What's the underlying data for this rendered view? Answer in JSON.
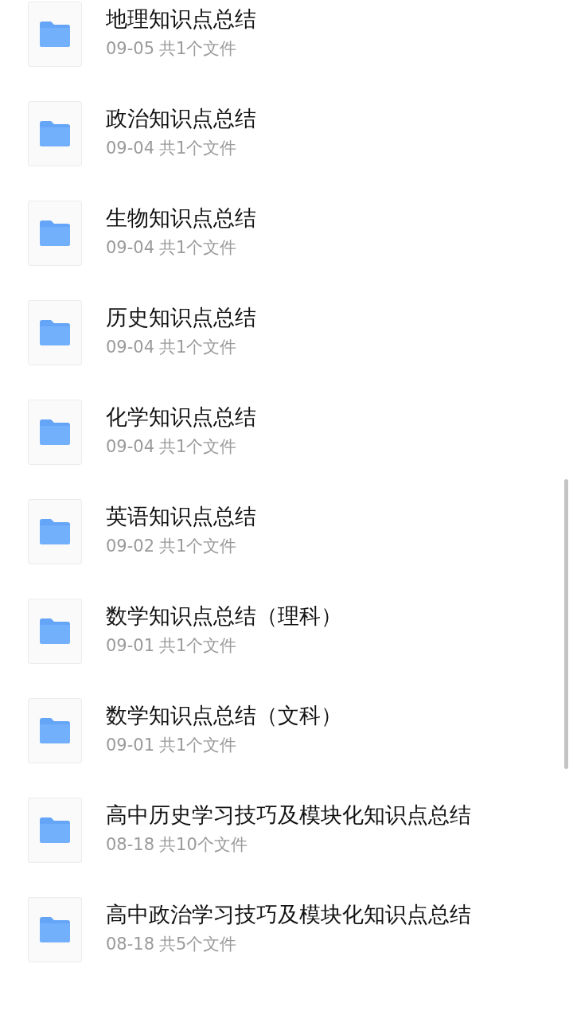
{
  "folders": [
    {
      "name": "地理知识点总结",
      "date": "09-05",
      "count": "共1个文件"
    },
    {
      "name": "政治知识点总结",
      "date": "09-04",
      "count": "共1个文件"
    },
    {
      "name": "生物知识点总结",
      "date": "09-04",
      "count": "共1个文件"
    },
    {
      "name": "历史知识点总结",
      "date": "09-04",
      "count": "共1个文件"
    },
    {
      "name": "化学知识点总结",
      "date": "09-04",
      "count": "共1个文件"
    },
    {
      "name": "英语知识点总结",
      "date": "09-02",
      "count": "共1个文件"
    },
    {
      "name": "数学知识点总结（理科）",
      "date": "09-01",
      "count": "共1个文件"
    },
    {
      "name": "数学知识点总结（文科）",
      "date": "09-01",
      "count": "共1个文件"
    },
    {
      "name": "高中历史学习技巧及模块化知识点总结",
      "date": "08-18",
      "count": "共10个文件"
    },
    {
      "name": "高中政治学习技巧及模块化知识点总结",
      "date": "08-18",
      "count": "共5个文件"
    }
  ]
}
